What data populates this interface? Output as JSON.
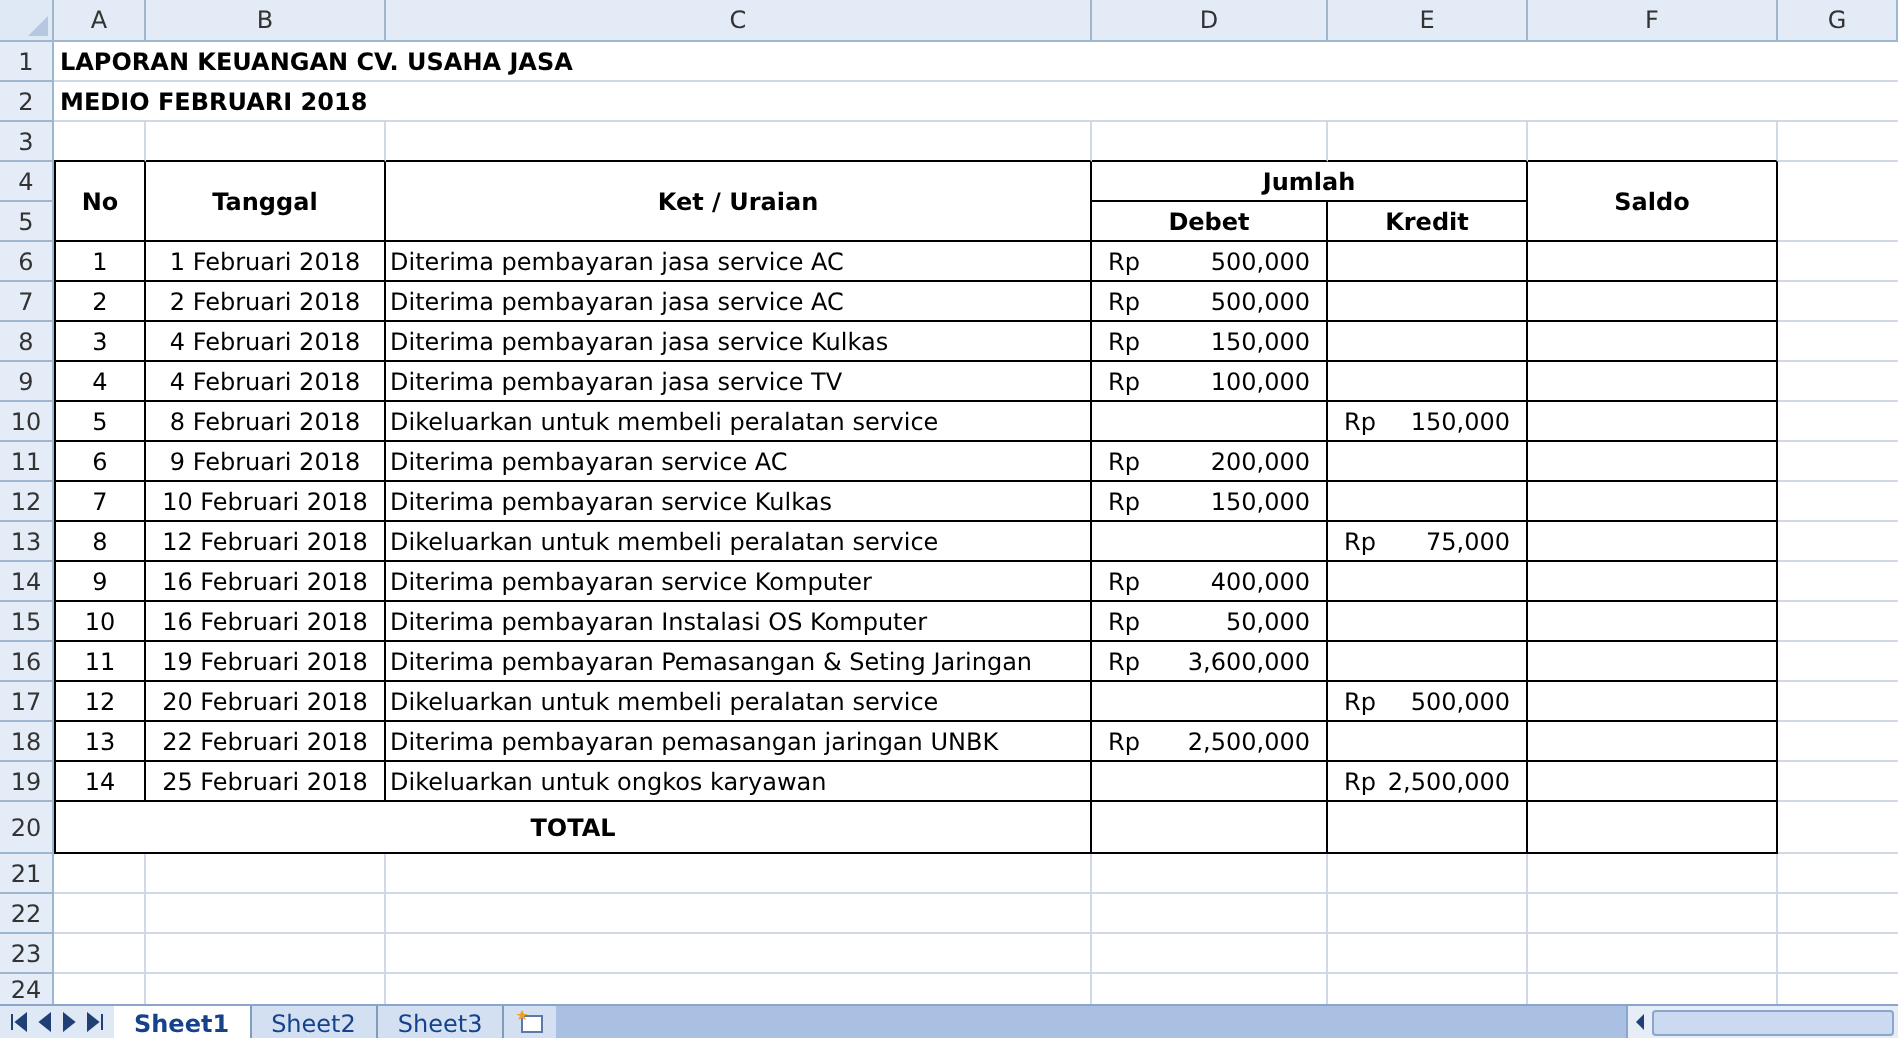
{
  "column_headers": [
    "A",
    "B",
    "C",
    "D",
    "E",
    "F",
    "G"
  ],
  "row_numbers": [
    "1",
    "2",
    "3",
    "4",
    "5",
    "6",
    "7",
    "8",
    "9",
    "10",
    "11",
    "12",
    "13",
    "14",
    "15",
    "16",
    "17",
    "18",
    "19",
    "20",
    "21",
    "22",
    "23",
    "24"
  ],
  "title_lines": [
    "LAPORAN KEUANGAN CV. USAHA JASA",
    "MEDIO FEBRUARI 2018"
  ],
  "table_header": {
    "no": "No",
    "date": "Tanggal",
    "description": "Ket / Uraian",
    "amount_group": "Jumlah",
    "debit": "Debet",
    "credit": "Kredit",
    "balance": "Saldo"
  },
  "rows": [
    {
      "no": "1",
      "date": "1 Februari 2018",
      "description": "Diterima pembayaran jasa service AC",
      "debit": {
        "currency": "Rp",
        "amount": "500,000"
      }
    },
    {
      "no": "2",
      "date": "2 Februari 2018",
      "description": "Diterima pembayaran jasa service AC",
      "debit": {
        "currency": "Rp",
        "amount": "500,000"
      }
    },
    {
      "no": "3",
      "date": "4 Februari 2018",
      "description": "Diterima pembayaran jasa service Kulkas",
      "debit": {
        "currency": "Rp",
        "amount": "150,000"
      }
    },
    {
      "no": "4",
      "date": "4 Februari 2018",
      "description": "Diterima pembayaran jasa service TV",
      "debit": {
        "currency": "Rp",
        "amount": "100,000"
      }
    },
    {
      "no": "5",
      "date": "8 Februari 2018",
      "description": "Dikeluarkan untuk membeli peralatan service",
      "credit": {
        "currency": "Rp",
        "amount": "150,000"
      }
    },
    {
      "no": "6",
      "date": "9 Februari 2018",
      "description": "Diterima pembayaran service AC",
      "debit": {
        "currency": "Rp",
        "amount": "200,000"
      }
    },
    {
      "no": "7",
      "date": "10 Februari 2018",
      "description": "Diterima pembayaran service Kulkas",
      "debit": {
        "currency": "Rp",
        "amount": "150,000"
      }
    },
    {
      "no": "8",
      "date": "12 Februari 2018",
      "description": "Dikeluarkan untuk membeli peralatan service",
      "credit": {
        "currency": "Rp",
        "amount": "75,000"
      }
    },
    {
      "no": "9",
      "date": "16 Februari 2018",
      "description": "Diterima pembayaran service Komputer",
      "debit": {
        "currency": "Rp",
        "amount": "400,000"
      }
    },
    {
      "no": "10",
      "date": "16 Februari 2018",
      "description": "Diterima pembayaran Instalasi OS Komputer",
      "debit": {
        "currency": "Rp",
        "amount": "50,000"
      }
    },
    {
      "no": "11",
      "date": "19 Februari 2018",
      "description": "Diterima pembayaran Pemasangan & Seting Jaringan",
      "debit": {
        "currency": "Rp",
        "amount": "3,600,000"
      }
    },
    {
      "no": "12",
      "date": "20 Februari 2018",
      "description": "Dikeluarkan untuk membeli peralatan service",
      "credit": {
        "currency": "Rp",
        "amount": "500,000"
      }
    },
    {
      "no": "13",
      "date": "22 Februari 2018",
      "description": "Diterima pembayaran pemasangan jaringan UNBK",
      "debit": {
        "currency": "Rp",
        "amount": "2,500,000"
      }
    },
    {
      "no": "14",
      "date": "25 Februari 2018",
      "description": "Dikeluarkan untuk ongkos karyawan",
      "credit": {
        "currency": "Rp",
        "amount": "2,500,000"
      }
    }
  ],
  "total_label": "TOTAL",
  "sheet_tabs": [
    {
      "label": "Sheet1",
      "selected": true
    },
    {
      "label": "Sheet2",
      "selected": false
    },
    {
      "label": "Sheet3",
      "selected": false
    }
  ]
}
